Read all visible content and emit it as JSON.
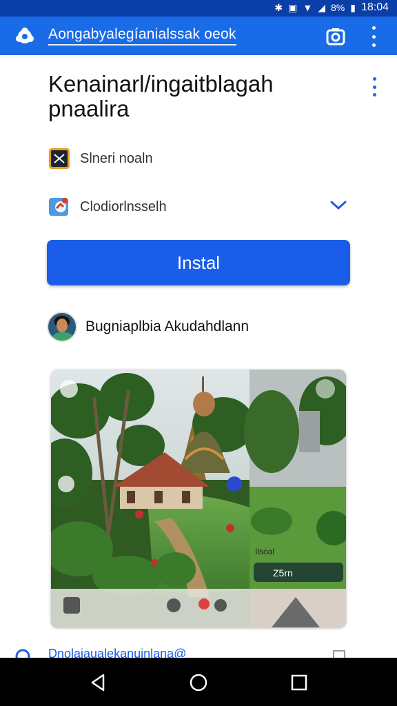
{
  "status_bar": {
    "battery": "8%",
    "time": "18:04"
  },
  "top_bar": {
    "title": "Aongabyalegíanialssak oeok"
  },
  "app": {
    "name": "Kenainarl/ingaitblagah pnaalira",
    "rows": [
      {
        "label": "Slneri noaln",
        "icon": "app-icon"
      },
      {
        "label": "Clodiorlnsselh",
        "icon": "share-icon"
      }
    ],
    "install_label": "Instal",
    "developer": "Bugniaplbia Akudahdlann",
    "screenshot": {
      "caption_small": "Ilsoal",
      "caption_badge": "Z5rn"
    },
    "bottom_link": "Dnolaiaualekanuinlana@"
  },
  "colors": {
    "primary": "#1a6be8",
    "status_bar": "#0a3fa8",
    "button": "#1a5de8"
  }
}
